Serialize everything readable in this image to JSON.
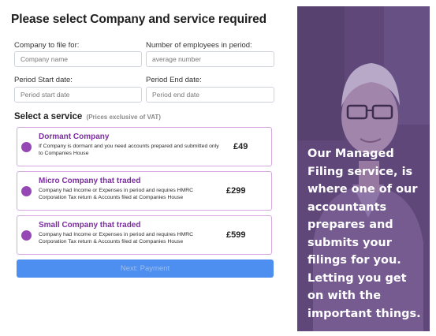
{
  "form": {
    "title": "Please select Company and service required",
    "company_label": "Company to file for:",
    "company_placeholder": "Company name",
    "employees_label": "Number of employees in period:",
    "employees_placeholder": "average number",
    "start_label": "Period Start date:",
    "start_placeholder": "Period start date",
    "end_label": "Period End date:",
    "end_placeholder": "Period end date"
  },
  "services": {
    "title": "Select a service",
    "note": "(Prices exclusive of VAT)",
    "items": [
      {
        "name": "Dormant Company",
        "description": "If Company is dormant and you need accounts prepared and submitted only to Companies House",
        "price": "£49"
      },
      {
        "name": "Micro Company that traded",
        "description": "Company had Income or Expenses in period and requires HMRC Corporation Tax return & Accounts filed at Companies House",
        "price": "£299"
      },
      {
        "name": "Small Company that traded",
        "description": "Company had Income or Expenses in period and requires HMRC Corporation Tax return & Accounts filed at Companies House",
        "price": "£599"
      }
    ]
  },
  "next_button_label": "Next: Payment",
  "promo": {
    "text": "Our Managed Filing service, is where one of our accountants prepares and submits your filings for you. Letting you get on with the important things."
  },
  "colors": {
    "accent_purple": "#9548b5",
    "card_border": "#d5a8e2",
    "service_name": "#7b2f9f",
    "button_blue": "#4d8ff0",
    "panel_overlay": "#6b4f86"
  }
}
